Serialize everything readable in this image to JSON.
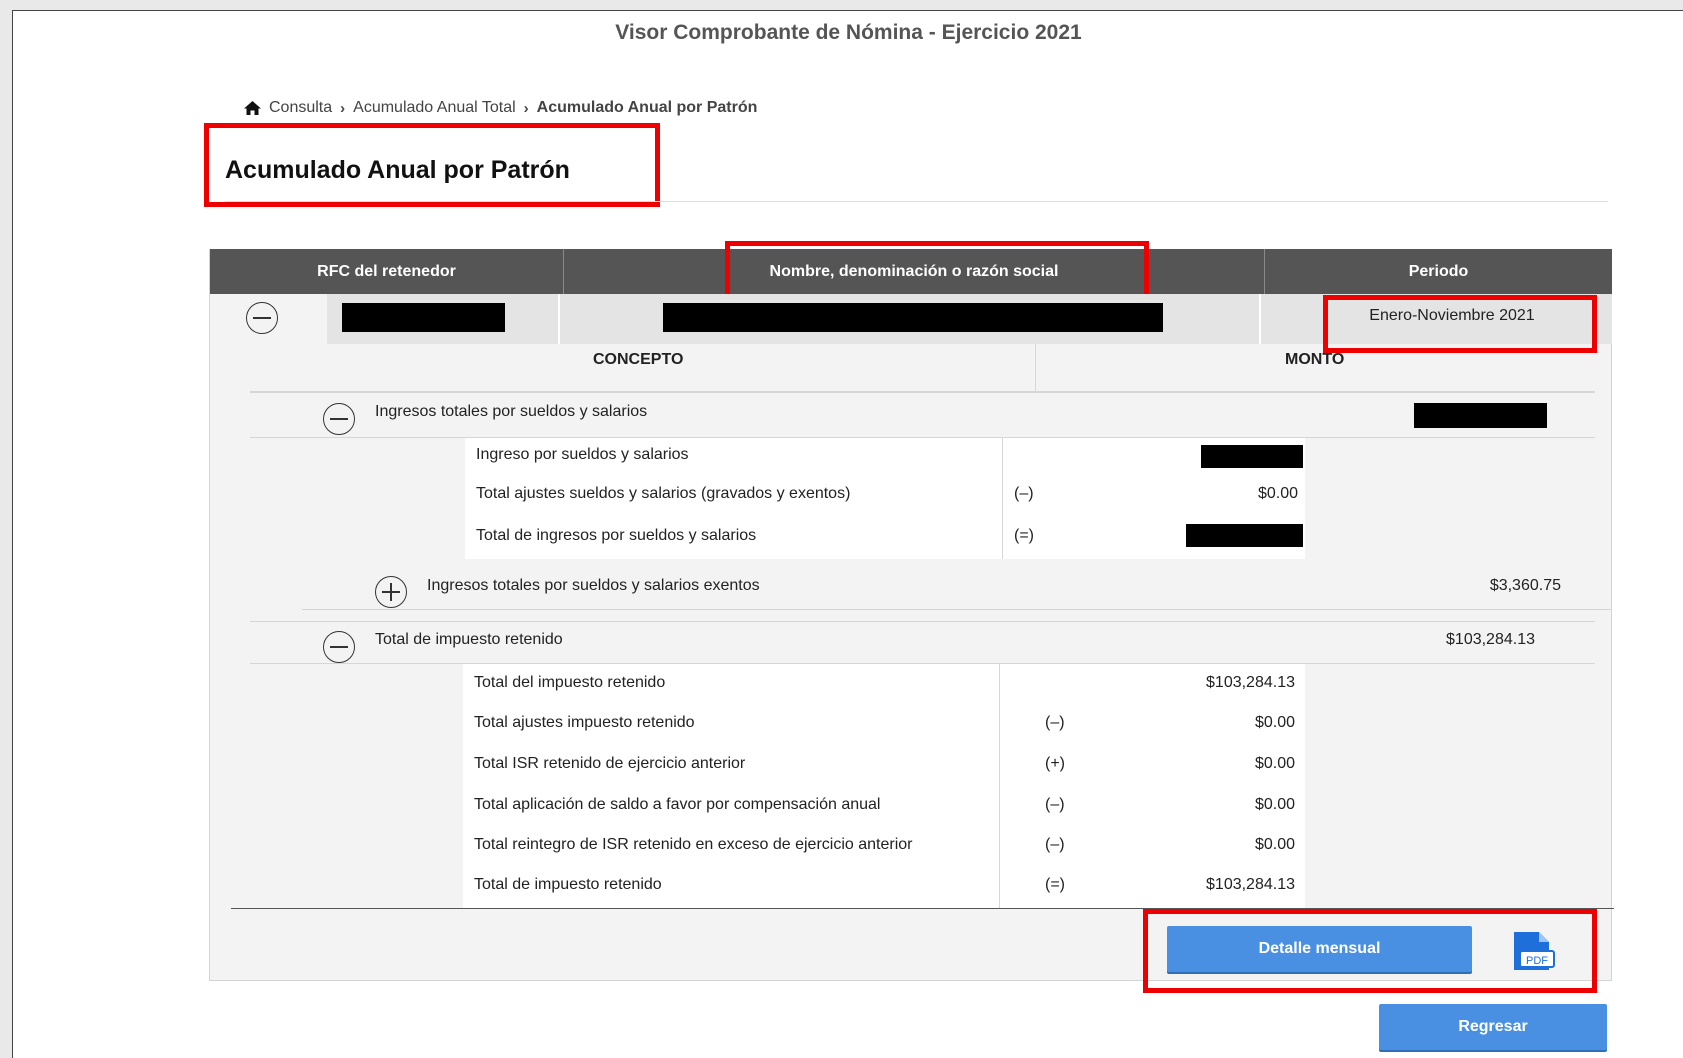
{
  "app_title": "Visor Comprobante de Nómina - Ejercicio 2021",
  "breadcrumb": {
    "items": [
      "Consulta",
      "Acumulado Anual Total"
    ],
    "current": "Acumulado Anual por Patrón",
    "home_icon": "home-icon",
    "separator": "›"
  },
  "page_title": "Acumulado Anual por Patrón",
  "table_headers": {
    "rfc": "RFC del retenedor",
    "nombre": "Nombre, denominación o razón social",
    "periodo": "Periodo"
  },
  "employer_row": {
    "periodo": "Enero-Noviembre 2021"
  },
  "concept_headers": {
    "concepto": "CONCEPTO",
    "monto": "MONTO"
  },
  "sections": {
    "ingresos": {
      "label": "Ingresos totales por sueldos y salarios",
      "items": [
        {
          "label": "Ingreso por sueldos y salarios",
          "op": "",
          "amount": ""
        },
        {
          "label": "Total ajustes sueldos y salarios (gravados y exentos)",
          "op": "(–)",
          "amount": "$0.00"
        },
        {
          "label": "Total de ingresos por sueldos y salarios",
          "op": "(=)",
          "amount": ""
        }
      ]
    },
    "exentos": {
      "label": "Ingresos totales por sueldos y salarios exentos",
      "amount": "$3,360.75"
    },
    "impuesto": {
      "label": "Total de impuesto retenido",
      "amount": "$103,284.13",
      "items": [
        {
          "label": "Total del impuesto retenido",
          "op": "",
          "amount": "$103,284.13"
        },
        {
          "label": "Total ajustes impuesto retenido",
          "op": "(–)",
          "amount": "$0.00"
        },
        {
          "label": "Total ISR retenido de ejercicio anterior",
          "op": "(+)",
          "amount": "$0.00"
        },
        {
          "label": "Total aplicación de saldo a favor por compensación anual",
          "op": "(–)",
          "amount": "$0.00"
        },
        {
          "label": "Total reintegro de ISR retenido en exceso de ejercicio anterior",
          "op": "(–)",
          "amount": "$0.00"
        },
        {
          "label": "Total de impuesto retenido",
          "op": "(=)",
          "amount": "$103,284.13"
        }
      ]
    }
  },
  "actions": {
    "detalle": "Detalle mensual",
    "pdf_icon": "pdf-icon",
    "pdf_label": "PDF",
    "regresar": "Regresar"
  },
  "colors": {
    "header_bg": "#555555",
    "accent_blue": "#4a90e2",
    "highlight_red": "#ee0000"
  }
}
